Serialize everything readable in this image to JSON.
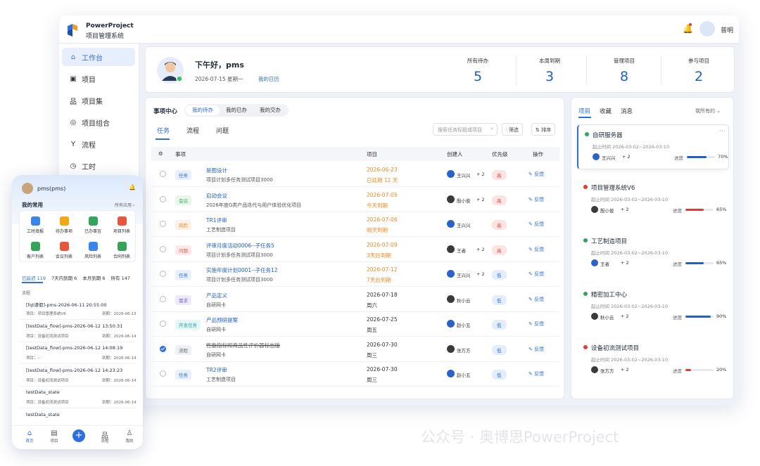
{
  "brand": {
    "line1": "PowerProject",
    "line2": "项目管理系统"
  },
  "header": {
    "user_name": "普明"
  },
  "sidebar": {
    "items": [
      {
        "label": "工作台",
        "icon": "home-icon"
      },
      {
        "label": "项目",
        "icon": "project-icon"
      },
      {
        "label": "项目集",
        "icon": "program-icon"
      },
      {
        "label": "项目组合",
        "icon": "portfolio-icon"
      },
      {
        "label": "流程",
        "icon": "flow-icon"
      },
      {
        "label": "工时",
        "icon": "clock-icon"
      }
    ]
  },
  "welcome": {
    "greeting": "下午好，pms",
    "date": "2026-07-15  星期一",
    "link": "我的日历"
  },
  "stats": [
    {
      "label": "所有待办",
      "value": "5"
    },
    {
      "label": "本周到期",
      "value": "3"
    },
    {
      "label": "管理项目",
      "value": "8"
    },
    {
      "label": "参与项目",
      "value": "2"
    }
  ],
  "tasks": {
    "title": "事项中心",
    "pills": [
      "我的待办",
      "我的已办",
      "我的交办"
    ],
    "tabs": [
      "任务",
      "流程",
      "问题"
    ],
    "search_placeholder": "搜索任务标题或项目",
    "filter_label": "筛选",
    "sort_label": "排序",
    "columns": {
      "item": "事项",
      "project": "项目",
      "creator": "创建人",
      "priority": "优先级",
      "action": "操作"
    },
    "rows": [
      {
        "type": "任务",
        "name": "是图设计",
        "project": "项目计划多任务测试项目3000",
        "date": "2026-06-23",
        "sub": "已延期 12 天",
        "creator": "王兴兴",
        "count": "+ 2",
        "priority": "高",
        "action": "反馈"
      },
      {
        "type": "会议",
        "name": "启动会议",
        "project": "2026年度G类产品迭代与用户体验优化项目",
        "date": "2026-07-05",
        "sub": "今天到期",
        "creator": "殷小俊",
        "count": "+ 2",
        "priority": "高",
        "action": "反馈"
      },
      {
        "type": "风险",
        "name": "TR1评审",
        "project": "工艺制造项目",
        "date": "2026-07-06",
        "sub": "明天到期",
        "creator": "王兴兴",
        "count": "",
        "priority": "高",
        "action": "反馈"
      },
      {
        "type": "问题",
        "name": "评审月度活动0006--子任务5",
        "project": "项目计划多任务测试项目3000",
        "date": "2026-07-09",
        "sub": "3天后到期",
        "creator": "王者",
        "count": "+ 2",
        "priority": "高",
        "action": "反馈"
      },
      {
        "type": "任务",
        "name": "实施年度计划0001--子任务12",
        "project": "项目计划多任务测试项目3000",
        "date": "2026-07-12",
        "sub": "7天后到期",
        "creator": "王兴兴",
        "count": "+ 2",
        "priority": "低",
        "action": "反馈"
      },
      {
        "type": "需求",
        "name": "产品定义",
        "project": "自研网卡",
        "date": "2026-07-18",
        "sub": "周六",
        "creator": "秋小云",
        "count": "",
        "priority": "低",
        "action": "反馈"
      },
      {
        "type": "开发任务",
        "name": "产品预研提案",
        "project": "自研网卡",
        "date": "2026-07-25",
        "sub": "周五",
        "creator": "赵小五",
        "count": "",
        "priority": "低",
        "action": "反馈"
      },
      {
        "type": "流程",
        "name": "性能指标和商品性评价器标出版",
        "project": "自研网卡",
        "date": "2026-07-30",
        "sub": "周三",
        "creator": "张方方",
        "count": "",
        "priority": "低",
        "action": "反馈"
      },
      {
        "type": "任务",
        "name": "TR2评审",
        "project": "工艺制造项目",
        "date": "2026-07-30",
        "sub": "周三",
        "creator": "赵小五",
        "count": "",
        "priority": "低",
        "action": "反馈"
      }
    ]
  },
  "right_panel": {
    "tabs": [
      "项目",
      "收藏",
      "消息"
    ],
    "filter": "我所有的",
    "start_label": "起止时间",
    "progress_label": "进度",
    "projects": [
      {
        "name": "自研服务器",
        "dates": "2026-03-02~2026-03-10",
        "owner": "王兴兴",
        "count": "+ 2",
        "progress": 70,
        "progress_text": "70%",
        "dot": "#35a35a",
        "bar": "#1f5fc9"
      },
      {
        "name": "项目管理系统V6",
        "dates": "2026-03-02~2026-03-10",
        "owner": "殷小俊",
        "count": "+ 2",
        "progress": 65,
        "progress_text": "65%",
        "dot": "#e53935",
        "bar": "#e53935"
      },
      {
        "name": "工艺制造项目",
        "dates": "2026-03-02~2026-03-10",
        "owner": "王者",
        "count": "+ 2",
        "progress": 65,
        "progress_text": "65%",
        "dot": "#35a35a",
        "bar": "#1f5fc9"
      },
      {
        "name": "精密加工中心",
        "dates": "2026-03-02~2026-03-10",
        "owner": "秋小云",
        "count": "+ 2",
        "progress": 90,
        "progress_text": "90%",
        "dot": "#35a35a",
        "bar": "#1f5fc9"
      },
      {
        "name": "设备初流测试项目",
        "dates": "2026-03-02~2026-03-10",
        "owner": "张方方",
        "count": "+ 2",
        "progress": 20,
        "progress_text": "20%",
        "dot": "#e53935",
        "bar": "#e53935"
      }
    ]
  },
  "mobile": {
    "user": "pms(pms)",
    "section": "我的常用",
    "all_apps": "所有应用",
    "apps": [
      {
        "label": "工时填报",
        "color": "#3a86e8"
      },
      {
        "label": "待办事项",
        "color": "#f3a712"
      },
      {
        "label": "已办事宜",
        "color": "#35a35a"
      },
      {
        "label": "项目列表",
        "color": "#e8553a"
      },
      {
        "label": "客户列表",
        "color": "#35a35a"
      },
      {
        "label": "会议列表",
        "color": "#e8553a"
      },
      {
        "label": "风险列表",
        "color": "#3a86e8"
      },
      {
        "label": "合同列表",
        "color": "#35a35a"
      }
    ],
    "tabs": [
      "已延迟 119",
      "7天内到期 6",
      "本月到期 6",
      "所有 147"
    ],
    "flow_label": "流程",
    "items": [
      {
        "title": "[fqt请假]-pms-2026-06-11 20:55:00",
        "project": "项目：项目管理系统V6",
        "due": "到期：2026-06-13"
      },
      {
        "title": "[testData_flow]-pms-2026-06-12 13:50:31",
        "project": "项目：设备初流测试项目",
        "due": "到期：2026-06-14"
      },
      {
        "title": "[testData_flow]-pms-2026-06-12 14:08:19",
        "project": "项目：--",
        "due": "到期：2026-06-14"
      },
      {
        "title": "[testData_flow]-pms-2026-06-12 14:23:23",
        "project": "项目：设备初流测试项目",
        "due": "到期：2026-06-14"
      },
      {
        "title": "testData_state",
        "project": "项目：设备初流测试项目",
        "due": "到期：2026-06-14"
      },
      {
        "title": "testData_state",
        "project": "",
        "due": ""
      }
    ],
    "nav": [
      "首页",
      "项目",
      "",
      "流程",
      "我的"
    ]
  },
  "watermark": "公众号 · 奥博思PowerProject"
}
